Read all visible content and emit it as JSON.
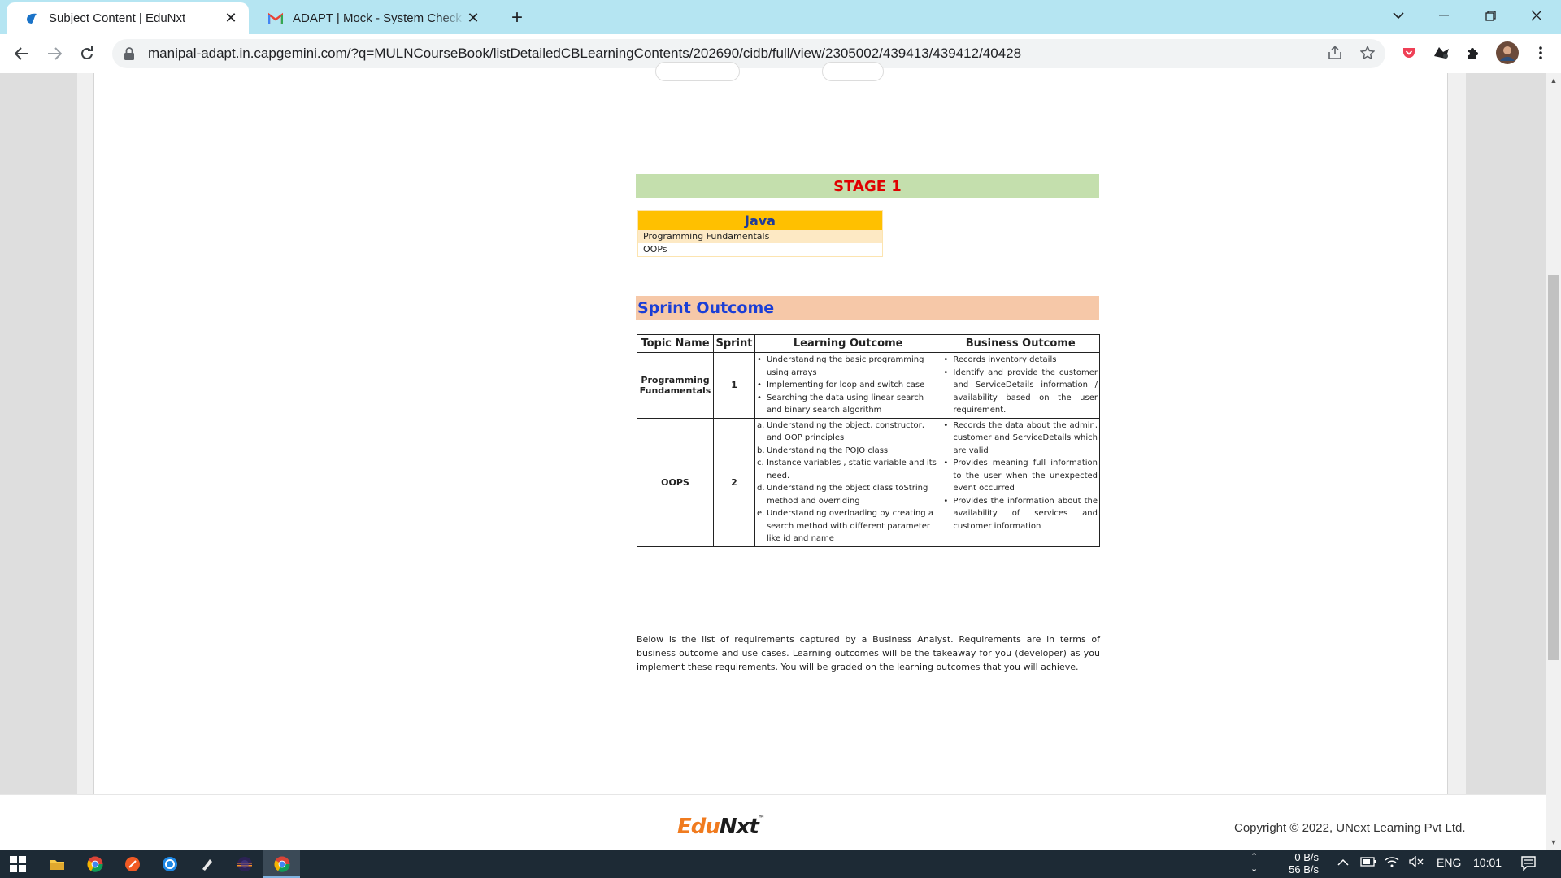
{
  "browser": {
    "tabs": [
      {
        "title": "Subject Content | EduNxt",
        "active": true,
        "icon": "edunxt-favicon"
      },
      {
        "title": "ADAPT | Mock - System Check Ass",
        "active": false,
        "icon": "gmail-favicon"
      }
    ],
    "url": "manipal-adapt.in.capgemini.com/?q=MULNCourseBook/listDetailedCBLearningContents/202690/cidb/full/view/2305002/439413/439412/40428"
  },
  "document": {
    "stage_title": "STAGE 1",
    "java": {
      "header": "Java",
      "rows": [
        "Programming Fundamentals",
        "OOPs"
      ]
    },
    "sprint_title": "Sprint Outcome",
    "table": {
      "headers": [
        "Topic Name",
        "Sprint",
        "Learning Outcome",
        "Business Outcome"
      ],
      "rows": [
        {
          "topic": "Programming Fundamentals",
          "sprint": "1",
          "learning": [
            "Understanding the basic programming using arrays",
            "Implementing for loop and switch case",
            "Searching the data using linear search and binary search algorithm"
          ],
          "business": [
            "Records inventory details",
            "Identify and provide the customer and ServiceDetails information / availability based on the user requirement."
          ]
        },
        {
          "topic": "OOPS",
          "sprint": "2",
          "learning": [
            "Understanding the object, constructor, and OOP principles",
            "Understanding the POJO class",
            "Instance variables , static variable and its need.",
            "Understanding the object class toString method and overriding",
            "Understanding overloading by creating a search method with different parameter like id and name"
          ],
          "business": [
            "Records the data about the admin, customer and ServiceDetails which are valid",
            "Provides meaning full information to the user when the unexpected event occurred",
            "Provides the information about the availability of services and customer information"
          ]
        }
      ]
    },
    "note": "Below is the list of requirements captured by a Business Analyst.  Requirements are in terms of business outcome and use cases. Learning outcomes will be the takeaway for you (developer) as you implement these requirements. You will be graded on the learning outcomes that you will achieve."
  },
  "footer": {
    "logo_part1": "Edu",
    "logo_part2": "Nxt",
    "logo_tm": "™",
    "copyright": "Copyright © 2022, UNext Learning Pvt Ltd."
  },
  "taskbar": {
    "net_up": "0 B/s",
    "net_down": "56 B/s",
    "language": "ENG",
    "time": "10:01"
  },
  "colors": {
    "tabbar": "#b5e5f2",
    "stage_bg": "#c4dfad",
    "stage_text": "#e00000",
    "java_header": "#ffc000",
    "sprint_bg": "#f6c8a8",
    "sprint_text": "#1a3ed6",
    "logo_orange": "#f07b1f"
  }
}
